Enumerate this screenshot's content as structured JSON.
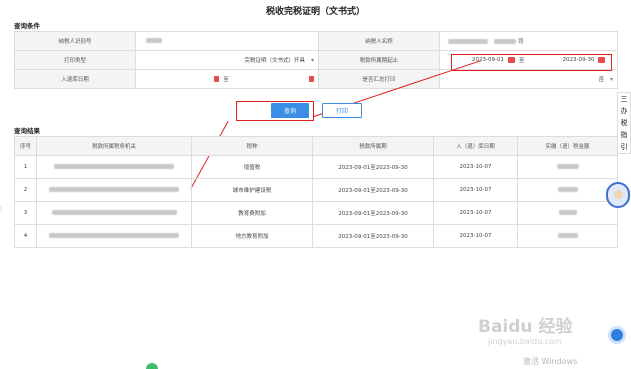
{
  "page": {
    "title": "税收完税证明（文书式）"
  },
  "conditions": {
    "section_title": "查询条件",
    "taxpayer_id_label": "纳税人识别号",
    "taxpayer_name_label": "纳税人名称",
    "taxpayer_name_suffix": "司",
    "print_type_label": "打印类型",
    "print_type_value": "完税证明（文书式）开具",
    "tax_period_label": "税款所属期起止",
    "tax_period_start": "2023-09-01",
    "tax_period_sep": "至",
    "tax_period_end": "2023-09-30",
    "storage_date_label": "入退库日期",
    "storage_date_sep": "至",
    "summary_print_label": "是否汇总打印",
    "summary_print_value": "否"
  },
  "buttons": {
    "query": "查询",
    "print": "打印"
  },
  "results": {
    "section_title": "查询结果",
    "columns": [
      "序号",
      "税款所属税务机关",
      "税种",
      "税款所属期",
      "入（退）库日期",
      "实缴（退）税金额"
    ],
    "rows": [
      {
        "no": "1",
        "tax_type": "增值税",
        "period": "2023-09-01至2023-09-30",
        "date": "2023-10-07"
      },
      {
        "no": "2",
        "tax_type": "城市维护建设税",
        "period": "2023-09-01至2023-09-30",
        "date": "2023-10-07"
      },
      {
        "no": "3",
        "tax_type": "教育费附加",
        "period": "2023-09-01至2023-09-30",
        "date": "2023-10-07"
      },
      {
        "no": "4",
        "tax_type": "地方教育附加",
        "period": "2023-09-01至2023-09-30",
        "date": "2023-10-07"
      }
    ]
  },
  "side_guide": {
    "text": "三 办 税 指 引"
  },
  "watermark": {
    "logo": "Baidu 经验",
    "url": "jingyan.baidu.com",
    "activate": "激活 Windows"
  },
  "colors": {
    "primary": "#3a8ee6",
    "highlight": "#e02020",
    "header_bg": "#f4f4f4"
  }
}
